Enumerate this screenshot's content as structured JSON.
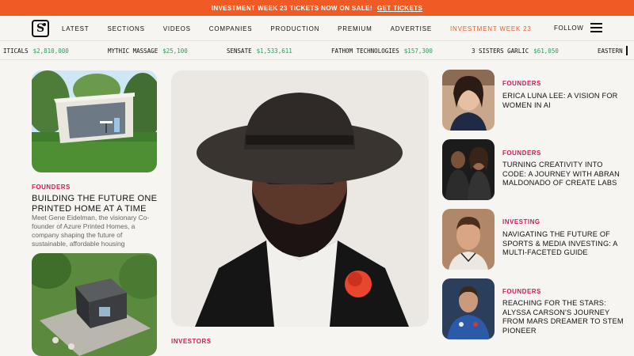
{
  "promo": {
    "text": "INVESTMENT WEEK 23 TICKETS NOW ON SALE!",
    "cta": "GET TICKETS"
  },
  "logo": {
    "letter": "S"
  },
  "nav": {
    "items": [
      "LATEST",
      "SECTIONS",
      "VIDEOS",
      "COMPANIES",
      "PRODUCTION",
      "PREMIUM",
      "ADVERTISE",
      "INVESTMENT WEEK 23"
    ],
    "follow": "FOLLOW",
    "highlight_color": "#f05a24"
  },
  "ticker": [
    {
      "name": "ITICALS",
      "value": "$2,810,000"
    },
    {
      "name": "MYTHIC MASSAGE",
      "value": "$25,100"
    },
    {
      "name": "SENSATE",
      "value": "$1,533,611"
    },
    {
      "name": "FATHOM TECHNOLOGIES",
      "value": "$157,300"
    },
    {
      "name": "3 SISTERS GARLIC",
      "value": "$61,050"
    },
    {
      "name": "EASTERN",
      "value": ""
    }
  ],
  "left_article": {
    "category": "FOUNDERS",
    "headline": "BUILDING THE FUTURE ONE PRINTED HOME AT A TIME",
    "summary": "Meet Gene Eidelman, the visionary Co-founder of Azure Printed Homes, a company shaping the future of sustainable, affordable housing"
  },
  "center_article": {
    "category": "INVESTORS"
  },
  "right_articles": [
    {
      "category": "FOUNDERS",
      "headline": "ERICA LUNA LEE: A VISION FOR WOMEN IN AI"
    },
    {
      "category": "FOUNDERS",
      "headline": "TURNING CREATIVITY INTO CODE: A JOURNEY WITH ABRAN MALDONADO OF CREATE LABS"
    },
    {
      "category": "INVESTING",
      "headline": "NAVIGATING THE FUTURE OF SPORTS & MEDIA INVESTING: A MULTI-FACETED GUIDE"
    },
    {
      "category": "FOUNDERS",
      "headline": "REACHING FOR THE STARS: ALYSSA CARSON'S JOURNEY FROM MARS DREAMER TO STEM PIONEER"
    }
  ],
  "colors": {
    "accent": "#f05a24",
    "category": "#d61a5c",
    "ticker_value": "#2e9d5b",
    "background": "#f6f5f1"
  }
}
